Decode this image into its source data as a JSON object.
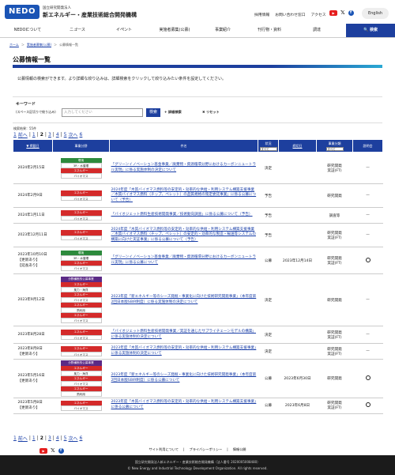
{
  "header": {
    "logo": "NEDO",
    "org_type": "国立研究開発法人",
    "org_name": "新エネルギー・産業技術総合開発機構",
    "links": [
      "採用情報",
      "お問い合わせ窓口",
      "アクセス"
    ],
    "english": "English"
  },
  "nav": {
    "items": [
      "NEDOについて",
      "ニュース",
      "イベント",
      "実施者募集(公募)",
      "事業紹介",
      "刊行物・資料",
      "調達"
    ],
    "search": "🔍 検索"
  },
  "breadcrumb": [
    "ホーム",
    "実施者募集(公募)",
    "公募情報一覧"
  ],
  "page": {
    "title": "公募情報一覧",
    "intro": "公募情報の検索ができます。より詳細な絞り込みは、詳細検索をクリックして絞り込みたい条件を設定してください。"
  },
  "keyword": {
    "label": "キーワード",
    "sub": "(スペース区切りで絞り込み)",
    "placeholder": "入力してください",
    "search_btn": "検索",
    "detail": "+ 詳細検索",
    "reset": "✖ リセット"
  },
  "results": {
    "count": "検索結果：55件",
    "pager": {
      "first": "1",
      "prev": "前へ",
      "pages": [
        "1",
        "2",
        "3",
        "4",
        "5"
      ],
      "next": "次へ",
      "last": "6"
    },
    "headers": {
      "date": "▼ 掲載日",
      "field": "事業分野",
      "title": "件名",
      "status": "状況",
      "status_sel": "すべて",
      "deadline": "締切日",
      "category": "事業分類",
      "category_sel": "すべて",
      "briefing": "説明会"
    },
    "rows": [
      {
        "date": "2024年2月15日",
        "notes": [],
        "tags": [
          {
            "t": "環境",
            "c": "green"
          },
          {
            "t": "3R・水循環",
            "c": "white"
          },
          {
            "t": "エネルギー",
            "c": "red"
          },
          {
            "t": "バイオマス",
            "c": "white"
          }
        ],
        "title": "「グリーンイノベーション基金事業／廃棄物・資源循環分野におけるカーボンニュートラル実現」に係る実施体制の決定について",
        "status": "決定",
        "deadline": "",
        "category": "研究開発\n実証(FT)",
        "briefing": "—"
      },
      {
        "date": "2024年2月9日",
        "notes": [],
        "tags": [
          {
            "t": "エネルギー",
            "c": "red"
          },
          {
            "t": "バイオマス",
            "c": "white"
          }
        ],
        "title": "2024年度「木質バイオマス燃料等の安定的・効率的な供給・利用システム構築支援事業／木質バイオマス燃料（チップ、ペレット）の品質規格の策定委託事業」に係る公募について（予告）",
        "status": "予告",
        "deadline": "",
        "category": "研究開発",
        "briefing": "—"
      },
      {
        "date": "2024年1月11日",
        "notes": [],
        "tags": [
          {
            "t": "エネルギー",
            "c": "red"
          },
          {
            "t": "バイオマス",
            "c": "white"
          }
        ],
        "title": "「バイオジェット燃料生産技術開発事業／技術動向調査」に係る公募について（予告）",
        "status": "予告",
        "deadline": "",
        "category": "調査等",
        "briefing": "—"
      },
      {
        "date": "2023年12月11日",
        "notes": [],
        "tags": [
          {
            "t": "エネルギー",
            "c": "red"
          },
          {
            "t": "バイオマス",
            "c": "white"
          }
        ],
        "title": "2024年度「木質バイオマス燃料等の安定的・効率的な供給・利用システム構築支援事業／木質バイオマス燃料（チップ、ペレット）の安定的・効率的な製造・輸送等システムの構築に向けた実証事業」に係る公募について（予告）",
        "status": "予告",
        "deadline": "",
        "category": "研究開発\n実証(FT)",
        "briefing": "—"
      },
      {
        "date": "2023年10月10日",
        "notes": [
          "【更新あり】",
          "【延長あり】"
        ],
        "tags": [
          {
            "t": "環境",
            "c": "green"
          },
          {
            "t": "3R・水循環",
            "c": "white"
          },
          {
            "t": "エネルギー",
            "c": "red"
          },
          {
            "t": "バイオマス",
            "c": "white"
          }
        ],
        "title": "「グリーンイノベーション基金事業／廃棄物・資源循環分野におけるカーボンニュートラル実現」に係る公募について",
        "status": "公募",
        "deadline": "2023年12月14日",
        "category": "研究開発\n実証(FT)",
        "briefing": "○"
      },
      {
        "date": "2023年9月12日",
        "notes": [],
        "tags": [
          {
            "t": "分野横断的公募事業",
            "c": "purple"
          },
          {
            "t": "エネルギー",
            "c": "red"
          },
          {
            "t": "風力・海洋",
            "c": "white"
          },
          {
            "t": "エネルギー",
            "c": "red"
          },
          {
            "t": "バイオマス",
            "c": "white"
          },
          {
            "t": "エネルギー",
            "c": "red"
          },
          {
            "t": "熱利用",
            "c": "white"
          },
          {
            "t": "エネルギー",
            "c": "red"
          },
          {
            "t": "バイオマス",
            "c": "white"
          }
        ],
        "title": "2023年度「新エネルギー等のシーズ発掘・事業化に向けた技術研究開発事業」（本年度第2回日本版SBIR制度）に係る実施体制の決定について",
        "status": "決定",
        "deadline": "",
        "category": "研究開発",
        "briefing": "—"
      },
      {
        "date": "2023年8月28日",
        "notes": [],
        "tags": [
          {
            "t": "エネルギー",
            "c": "red"
          },
          {
            "t": "バイオマス",
            "c": "white"
          }
        ],
        "title": "「バイオジェット燃料生産技術開発事業／実証を通じたサプライチェーンモデルの構築」に係る実施体制の決定について",
        "status": "決定",
        "deadline": "",
        "category": "研究開発\n実証(FT)",
        "briefing": "—"
      },
      {
        "date": "2023年8月8日",
        "notes": [
          "【更新あり】"
        ],
        "tags": [
          {
            "t": "エネルギー",
            "c": "red"
          },
          {
            "t": "バイオマス",
            "c": "white"
          }
        ],
        "title": "2023年度「木質バイオマス燃料等の安定的・効率的な供給・利用システム構築支援事業」に係る実施体制の決定について",
        "status": "決定",
        "deadline": "",
        "category": "研究開発\n実証(FT)",
        "briefing": "—"
      },
      {
        "date": "2023年5月16日",
        "notes": [
          "【更新あり】"
        ],
        "tags": [
          {
            "t": "分野横断的公募事業",
            "c": "purple"
          },
          {
            "t": "エネルギー",
            "c": "red"
          },
          {
            "t": "風力・海洋",
            "c": "white"
          },
          {
            "t": "エネルギー",
            "c": "red"
          },
          {
            "t": "バイオマス",
            "c": "white"
          },
          {
            "t": "エネルギー",
            "c": "red"
          },
          {
            "t": "熱利用",
            "c": "white"
          }
        ],
        "title": "2023年度「新エネルギー等のシーズ発掘・事業化に向けた技術研究開発事業」（本年度第2回日本版SBIR制度）に係る公募について",
        "status": "公募",
        "deadline": "2023年6月30日",
        "category": "研究開発",
        "briefing": "○"
      },
      {
        "date": "2023年5月8日",
        "notes": [
          "【更新あり】"
        ],
        "tags": [
          {
            "t": "エネルギー",
            "c": "red"
          },
          {
            "t": "バイオマス",
            "c": "white"
          }
        ],
        "title": "2023年度「木質バイオマス燃料等の安定的・効率的な供給・利用システム構築支援事業」に係る公募について",
        "status": "公募",
        "deadline": "2023年6月8日",
        "category": "研究開発\n実証(FT)",
        "briefing": "○"
      }
    ]
  },
  "footer": {
    "links": [
      "サイト利用について",
      "プライバシーポリシー",
      "情報公開"
    ],
    "address": "国立研究開発法人新エネルギー・産業技術総合開発機構（法人番号 2020005008480）",
    "copyright": "© New Energy and Industrial Technology Development Organization. All rights reserved."
  },
  "colors": {
    "primary": "#1d3f9e",
    "energy": "#d42a2a",
    "environment": "#2c8a3c",
    "crosscut": "#5b2a86"
  }
}
